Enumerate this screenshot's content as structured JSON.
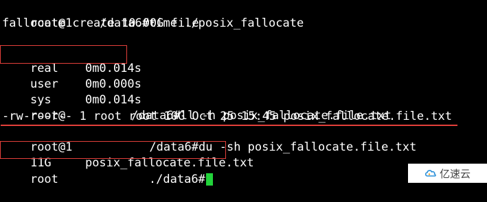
{
  "colors": {
    "background": "#000000",
    "text": "#ffffff",
    "cursor": "#22d33a",
    "annotation": "#e5403b"
  },
  "terminal": {
    "line1": {
      "prompt_user": "root@1",
      "prompt_path": "/data6#",
      "command": "time ./posix_fallocate"
    },
    "line2": {
      "text": "fallocate create 10.00G file"
    },
    "timing": [
      {
        "label": "real",
        "value": "0m0.014s"
      },
      {
        "label": "user",
        "value": "0m0.000s"
      },
      {
        "label": "sys",
        "value": "0m0.014s"
      }
    ],
    "line6": {
      "prompt_user": "root@",
      "prompt_path": "/data6#",
      "command": "ll -h posix_fallocate.file.txt"
    },
    "line7": {
      "text": "-rw-r--r-- 1 root root 10G Oct 25 15:45 posix_fallocate.file.txt"
    },
    "line8": {
      "prompt_user": "root@1",
      "prompt_path": "/data6#",
      "command": "du -sh posix_fallocate.file.txt"
    },
    "line9": {
      "size": "11G",
      "file": "posix_fallocate.file.txt"
    },
    "line10": {
      "prompt_user": "root",
      "prompt_path": "./data6#"
    }
  },
  "watermark": {
    "icon": "cloud-logo-icon",
    "text": "亿速云"
  }
}
